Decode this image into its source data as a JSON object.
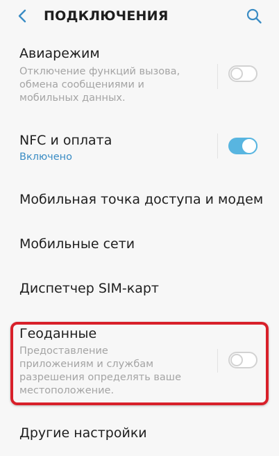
{
  "header": {
    "title": "ПОДКЛЮЧЕНИЯ",
    "back_icon": "chevron-left-icon",
    "search_icon": "search-icon"
  },
  "items": [
    {
      "title": "Авиарежим",
      "description_lines": [
        "Отключение функций вызова,",
        "обмена сообщениями и",
        "мобильных данных."
      ],
      "toggle": "off"
    },
    {
      "title": "NFC и оплата",
      "status": "Включено",
      "toggle": "on"
    },
    {
      "title": "Мобильная точка доступа и модем"
    },
    {
      "title": "Мобильные сети"
    },
    {
      "title": "Диспетчер SIM-карт"
    },
    {
      "title": "Геоданные",
      "description_lines": [
        "Предоставление",
        "приложениям и службам",
        "разрешения определять ваше",
        "местоположение."
      ],
      "toggle": "off",
      "highlighted": true
    },
    {
      "title": "Другие настройки"
    }
  ],
  "colors": {
    "background": "#f7f7f7",
    "accent": "#58b5e0",
    "status_text": "#3a8cc4",
    "highlight": "#d8202a"
  }
}
